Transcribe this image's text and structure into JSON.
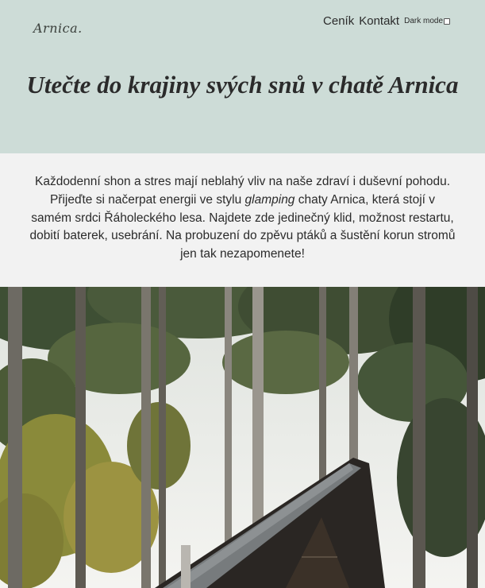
{
  "logo": "Arnica.",
  "nav": {
    "items": [
      "Ceník",
      "Kontakt"
    ],
    "dark_mode_label": "Dark mode",
    "dark_mode_checked": false
  },
  "hero": {
    "title": "Utečte do krajiny svých snů v chatě Arnica"
  },
  "intro": {
    "text_before": "Každodenní shon a stres mají neblahý vliv na naše zdraví i duševní pohodu. Přijeďte si načerpat energii ve stylu ",
    "text_emphasis": "glamping",
    "text_after": " chaty Arnica, která stojí v samém srdci Řáholeckého lesa. Najdete zde jedinečný klid, možnost restartu, dobití baterek, usebrání. Na probuzení do zpěvu ptáků a šustění korun stromů jen tak nezapomenete!"
  },
  "colors": {
    "header_bg": "#cddcd7",
    "body_bg": "#f2f2f2",
    "text": "#2b2b2b"
  }
}
